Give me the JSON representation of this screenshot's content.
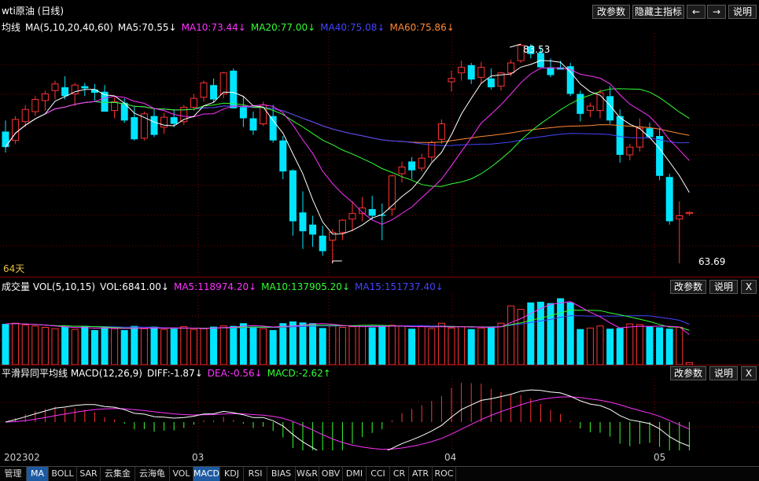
{
  "app": {
    "title": "wti原油 (日线)"
  },
  "toolbar": {
    "param": "改参数",
    "hide_indicator": "隐藏主指标",
    "prev": "←",
    "next": "→",
    "help": "说明"
  },
  "main": {
    "legend_label": "均线",
    "legend_params": "MA(5,10,20,40,60)",
    "ma5": "MA5:70.55↓",
    "ma10": "MA10:73.44↓",
    "ma20": "MA20:77.00↓",
    "ma40": "MA40:75.08↓",
    "ma60": "MA60:75.86↓",
    "days_label": "64天",
    "high_label": "83.53",
    "low_label": "63.69"
  },
  "volume": {
    "legend": "成交量 VOL(5,10,15)",
    "vol": "VOL:6841.00↓",
    "ma5": "MA5:118974.20↓",
    "ma10": "MA10:137905.20↓",
    "ma15": "MA15:151737.40↓",
    "param": "改参数",
    "help": "说明",
    "close": "X"
  },
  "macd": {
    "legend": "平滑异同平均线 MACD(12,26,9)",
    "diff": "DIFF:-1.87↓",
    "dea": "DEA:-0.56↓",
    "macd": "MACD:-2.62↑",
    "param": "改参数",
    "help": "说明",
    "close": "X"
  },
  "dates": [
    "202302",
    "03",
    "04",
    "05"
  ],
  "tabs": [
    "管理",
    "MA",
    "BOLL",
    "SAR",
    "云集金",
    "云海龟",
    "VOL",
    "MACD",
    "KDJ",
    "RSI",
    "BIAS",
    "W&R",
    "OBV",
    "DMI",
    "CCI",
    "CR",
    "ATR",
    "ROC"
  ],
  "active_tabs": [
    "MA",
    "MACD"
  ],
  "colors": {
    "up": "#ff3333",
    "down": "#00e5ff",
    "ma5": "#ffffff",
    "ma10": "#ff33ff",
    "ma20": "#33ff33",
    "ma40": "#4444ff",
    "ma60": "#ff8833",
    "grid": "#800000"
  },
  "chart_data": {
    "type": "candlestick",
    "y_range": [
      62.5,
      84.5
    ],
    "candles": [
      {
        "o": 75.6,
        "h": 76.6,
        "l": 73.7,
        "c": 74.2
      },
      {
        "o": 74.8,
        "h": 77.0,
        "l": 74.5,
        "c": 76.7
      },
      {
        "o": 76.5,
        "h": 78.0,
        "l": 76.0,
        "c": 77.6
      },
      {
        "o": 77.4,
        "h": 78.8,
        "l": 77.0,
        "c": 78.5
      },
      {
        "o": 78.4,
        "h": 79.3,
        "l": 77.5,
        "c": 79.0
      },
      {
        "o": 79.3,
        "h": 80.2,
        "l": 78.5,
        "c": 79.9
      },
      {
        "o": 79.6,
        "h": 80.6,
        "l": 78.5,
        "c": 78.8
      },
      {
        "o": 79.0,
        "h": 80.0,
        "l": 77.9,
        "c": 79.8
      },
      {
        "o": 79.7,
        "h": 80.0,
        "l": 78.8,
        "c": 79.5
      },
      {
        "o": 79.4,
        "h": 79.9,
        "l": 78.4,
        "c": 79.1
      },
      {
        "o": 79.2,
        "h": 79.8,
        "l": 77.7,
        "c": 77.4
      },
      {
        "o": 77.5,
        "h": 78.7,
        "l": 76.8,
        "c": 78.3
      },
      {
        "o": 78.2,
        "h": 78.6,
        "l": 76.4,
        "c": 76.6
      },
      {
        "o": 76.9,
        "h": 77.9,
        "l": 74.8,
        "c": 74.9
      },
      {
        "o": 75.0,
        "h": 77.4,
        "l": 74.8,
        "c": 77.2
      },
      {
        "o": 77.0,
        "h": 77.7,
        "l": 75.1,
        "c": 75.3
      },
      {
        "o": 76.0,
        "h": 77.3,
        "l": 75.4,
        "c": 76.9
      },
      {
        "o": 76.9,
        "h": 77.6,
        "l": 76.0,
        "c": 76.3
      },
      {
        "o": 76.5,
        "h": 78.0,
        "l": 76.2,
        "c": 77.8
      },
      {
        "o": 77.8,
        "h": 79.0,
        "l": 77.5,
        "c": 78.6
      },
      {
        "o": 78.7,
        "h": 80.2,
        "l": 78.3,
        "c": 80.0
      },
      {
        "o": 79.8,
        "h": 80.4,
        "l": 78.2,
        "c": 78.5
      },
      {
        "o": 79.0,
        "h": 81.0,
        "l": 78.6,
        "c": 80.9
      },
      {
        "o": 81.1,
        "h": 81.3,
        "l": 77.7,
        "c": 77.7
      },
      {
        "o": 77.8,
        "h": 78.8,
        "l": 76.0,
        "c": 76.8
      },
      {
        "o": 76.8,
        "h": 77.4,
        "l": 75.3,
        "c": 75.7
      },
      {
        "o": 76.3,
        "h": 78.3,
        "l": 76.1,
        "c": 78.0
      },
      {
        "o": 77.0,
        "h": 78.0,
        "l": 74.6,
        "c": 74.8
      },
      {
        "o": 74.8,
        "h": 75.2,
        "l": 71.3,
        "c": 72.0
      },
      {
        "o": 72.1,
        "h": 72.2,
        "l": 66.2,
        "c": 67.5
      },
      {
        "o": 68.3,
        "h": 70.2,
        "l": 65.0,
        "c": 66.6
      },
      {
        "o": 67.2,
        "h": 68.0,
        "l": 65.2,
        "c": 66.3
      },
      {
        "o": 66.2,
        "h": 67.1,
        "l": 64.4,
        "c": 64.8
      },
      {
        "o": 65.8,
        "h": 66.8,
        "l": 63.7,
        "c": 66.5
      },
      {
        "o": 66.5,
        "h": 67.7,
        "l": 65.8,
        "c": 67.6
      },
      {
        "o": 67.7,
        "h": 69.3,
        "l": 66.6,
        "c": 68.2
      },
      {
        "o": 68.2,
        "h": 69.7,
        "l": 67.5,
        "c": 68.7
      },
      {
        "o": 68.6,
        "h": 69.8,
        "l": 67.6,
        "c": 68.0
      },
      {
        "o": 68.1,
        "h": 69.1,
        "l": 65.8,
        "c": 68.0
      },
      {
        "o": 68.6,
        "h": 71.7,
        "l": 68.0,
        "c": 71.6
      },
      {
        "o": 71.8,
        "h": 72.9,
        "l": 71.0,
        "c": 72.4
      },
      {
        "o": 72.9,
        "h": 73.3,
        "l": 71.3,
        "c": 72.1
      },
      {
        "o": 72.3,
        "h": 73.6,
        "l": 72.0,
        "c": 73.2
      },
      {
        "o": 73.3,
        "h": 74.8,
        "l": 72.9,
        "c": 74.6
      },
      {
        "o": 74.9,
        "h": 76.7,
        "l": 74.5,
        "c": 76.3
      },
      {
        "o": 80.1,
        "h": 81.1,
        "l": 79.2,
        "c": 80.4
      },
      {
        "o": 80.9,
        "h": 82.0,
        "l": 80.2,
        "c": 81.4
      },
      {
        "o": 81.6,
        "h": 81.8,
        "l": 79.9,
        "c": 80.3
      },
      {
        "o": 80.5,
        "h": 81.9,
        "l": 80.0,
        "c": 81.4
      },
      {
        "o": 80.4,
        "h": 81.3,
        "l": 79.4,
        "c": 79.6
      },
      {
        "o": 79.7,
        "h": 81.0,
        "l": 79.3,
        "c": 80.9
      },
      {
        "o": 80.9,
        "h": 82.1,
        "l": 80.6,
        "c": 81.8
      },
      {
        "o": 82.0,
        "h": 83.5,
        "l": 81.8,
        "c": 83.4
      },
      {
        "o": 83.3,
        "h": 83.5,
        "l": 82.2,
        "c": 82.6
      },
      {
        "o": 82.7,
        "h": 83.2,
        "l": 81.4,
        "c": 81.4
      },
      {
        "o": 81.4,
        "h": 82.2,
        "l": 80.5,
        "c": 80.7
      },
      {
        "o": 81.4,
        "h": 82.0,
        "l": 81.2,
        "c": 81.2
      },
      {
        "o": 81.5,
        "h": 81.8,
        "l": 78.8,
        "c": 79.0
      },
      {
        "o": 79.0,
        "h": 79.3,
        "l": 76.5,
        "c": 77.2
      },
      {
        "o": 77.5,
        "h": 78.2,
        "l": 76.9,
        "c": 77.9
      },
      {
        "o": 77.5,
        "h": 79.4,
        "l": 76.8,
        "c": 79.1
      },
      {
        "o": 78.8,
        "h": 79.7,
        "l": 76.3,
        "c": 76.6
      },
      {
        "o": 77.0,
        "h": 77.6,
        "l": 72.8,
        "c": 73.5
      },
      {
        "o": 73.5,
        "h": 74.5,
        "l": 73.0,
        "c": 74.2
      },
      {
        "o": 74.2,
        "h": 76.8,
        "l": 73.8,
        "c": 75.9
      },
      {
        "o": 75.9,
        "h": 76.4,
        "l": 75.0,
        "c": 75.1
      },
      {
        "o": 75.2,
        "h": 75.9,
        "l": 71.2,
        "c": 71.6
      },
      {
        "o": 71.5,
        "h": 71.8,
        "l": 67.2,
        "c": 67.5
      },
      {
        "o": 67.7,
        "h": 69.3,
        "l": 63.7,
        "c": 68.0
      },
      {
        "o": 68.2,
        "h": 68.4,
        "l": 68.0,
        "c": 68.3
      }
    ],
    "volume": [
      118,
      120,
      115,
      112,
      108,
      104,
      110,
      102,
      112,
      100,
      108,
      104,
      100,
      112,
      104,
      110,
      102,
      104,
      110,
      102,
      104,
      110,
      112,
      112,
      120,
      110,
      104,
      100,
      120,
      125,
      122,
      120,
      106,
      112,
      108,
      110,
      114,
      108,
      112,
      114,
      112,
      104,
      110,
      104,
      120,
      106,
      110,
      103,
      106,
      110,
      120,
      170,
      160,
      180,
      182,
      178,
      192,
      180,
      103,
      106,
      112,
      104,
      106,
      118,
      116,
      110,
      108,
      104,
      108,
      6
    ]
  }
}
